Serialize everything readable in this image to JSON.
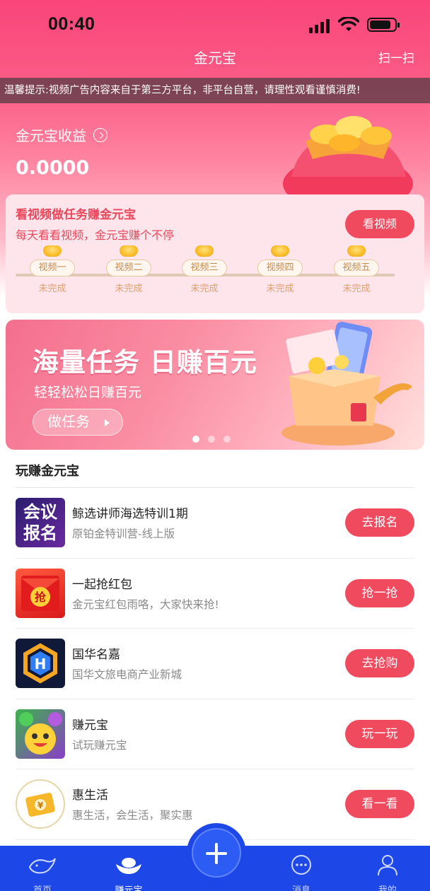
{
  "status_bar": {
    "time": "00:40"
  },
  "nav": {
    "title": "金元宝",
    "scan": "扫一扫"
  },
  "notice": "温馨提示:视频广告内容来自于第三方平台，非平台自营，请理性观看谨慎消费!",
  "earnings": {
    "label": "金元宝收益",
    "value": "0.0000"
  },
  "task_card": {
    "title": "看视频做任务赚金元宝",
    "subtitle": "每天看看视频，金元宝赚个不停",
    "button": "看视频",
    "steps": [
      {
        "label": "视频一",
        "status": "未完成"
      },
      {
        "label": "视频二",
        "status": "未完成"
      },
      {
        "label": "视频三",
        "status": "未完成"
      },
      {
        "label": "视频四",
        "status": "未完成"
      },
      {
        "label": "视频五",
        "status": "未完成"
      }
    ]
  },
  "banner": {
    "headline": "海量任务 日赚百元",
    "subtitle": "轻轻松松日赚百元",
    "button": "做任务",
    "page": 1,
    "page_count": 3
  },
  "section": {
    "title": "玩赚金元宝"
  },
  "items": [
    {
      "name": "鲸选讲师海选特训1期",
      "desc": "原铂金特训营-线上版",
      "action": "去报名",
      "thumb_text": "会议报名"
    },
    {
      "name": "一起抢红包",
      "desc": "金元宝红包雨咯，大家快来抢!",
      "action": "抢一抢",
      "thumb_text": "抢"
    },
    {
      "name": "国华名嘉",
      "desc": "国华文旅电商产业新城",
      "action": "去抢购",
      "thumb_text": "H"
    },
    {
      "name": "赚元宝",
      "desc": "试玩赚元宝",
      "action": "玩一玩"
    },
    {
      "name": "惠生活",
      "desc": "惠生活，会生活，聚实惠",
      "action": "看一看",
      "thumb_text": "¥"
    }
  ],
  "tabbar": {
    "tabs": [
      {
        "label": "首页",
        "icon": "whale-icon"
      },
      {
        "label": "赚元宝",
        "icon": "ingot-icon",
        "active": true
      },
      {
        "label": "",
        "icon": "plus-icon"
      },
      {
        "label": "消息",
        "icon": "chat-icon"
      },
      {
        "label": "我的",
        "icon": "user-icon"
      }
    ]
  },
  "colors": {
    "accent": "#f04a5f",
    "tabbar": "#1d47e6",
    "header": "#f9457a"
  }
}
